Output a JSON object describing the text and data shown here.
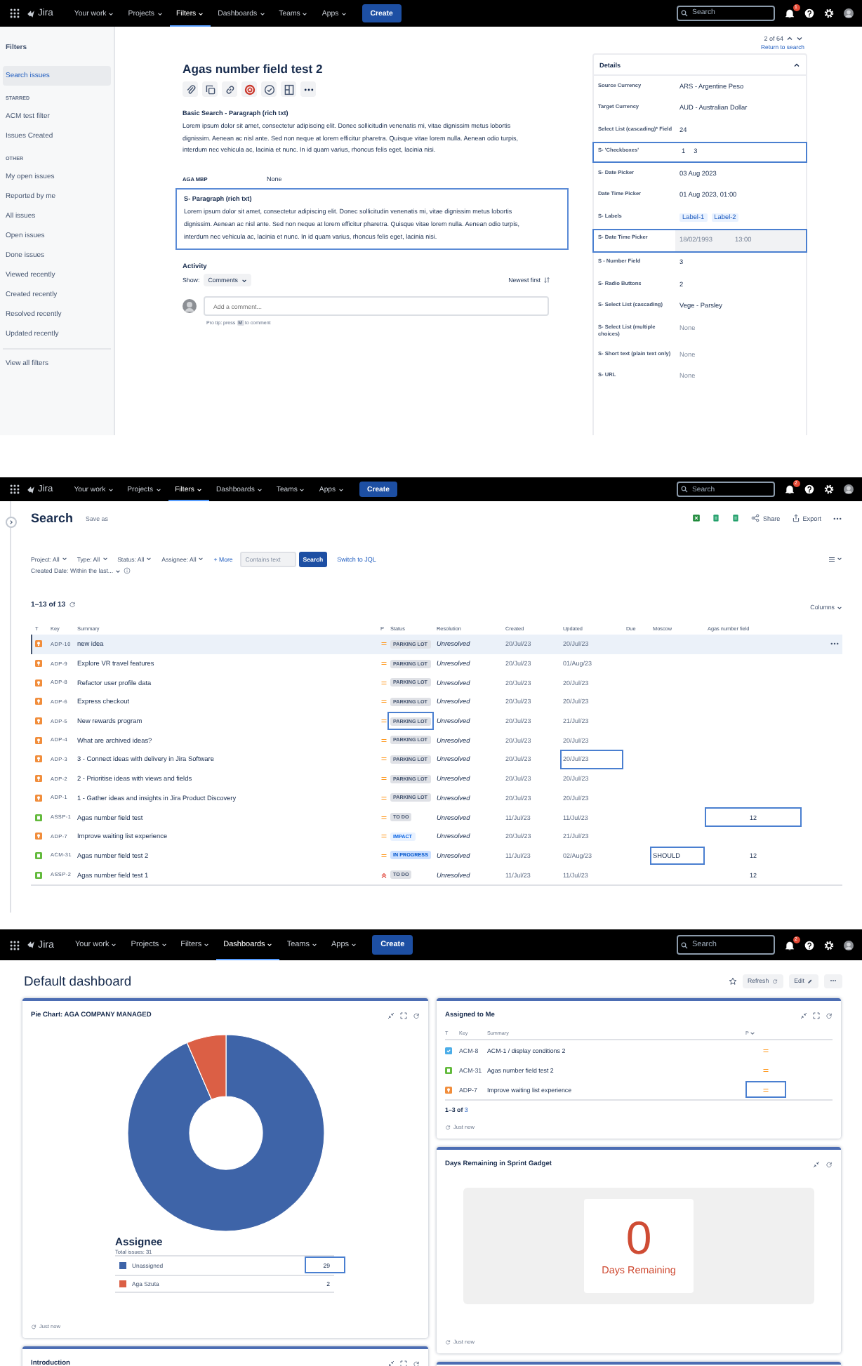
{
  "issue_view": {
    "nav": {
      "product": "Jira",
      "menus": [
        {
          "label": "Your work",
          "selected": false
        },
        {
          "label": "Projects",
          "selected": false
        },
        {
          "label": "Filters",
          "selected": true
        },
        {
          "label": "Dashboards",
          "selected": false
        },
        {
          "label": "Teams",
          "selected": false
        },
        {
          "label": "Apps",
          "selected": false
        }
      ],
      "create": "Create",
      "search_placeholder": "Search",
      "badge": "1"
    },
    "sidebar": {
      "title": "Filters",
      "items": [
        {
          "kind": "item",
          "label": "Search issues",
          "selected": true
        },
        {
          "kind": "heading",
          "label": "STARRED"
        },
        {
          "kind": "item",
          "label": "ACM test filter",
          "selected": false
        },
        {
          "kind": "item",
          "label": "Issues Created",
          "selected": false
        },
        {
          "kind": "heading",
          "label": "OTHER"
        },
        {
          "kind": "item",
          "label": "My open issues",
          "selected": false
        },
        {
          "kind": "item",
          "label": "Reported by me",
          "selected": false
        },
        {
          "kind": "item",
          "label": "All issues",
          "selected": false
        },
        {
          "kind": "item",
          "label": "Open issues",
          "selected": false
        },
        {
          "kind": "item",
          "label": "Done issues",
          "selected": false
        },
        {
          "kind": "item",
          "label": "Viewed recently",
          "selected": false
        },
        {
          "kind": "item",
          "label": "Created recently",
          "selected": false
        },
        {
          "kind": "item",
          "label": "Resolved recently",
          "selected": false
        },
        {
          "kind": "item",
          "label": "Updated recently",
          "selected": false
        }
      ],
      "footer": "View all filters"
    },
    "pager": {
      "position": "2 of 64",
      "link": "Return to search"
    },
    "title": "Agas number field test 2",
    "description": {
      "heading": "Basic Search - Paragraph (rich txt)",
      "text": "Lorem ipsum dolor sit amet, consectetur adipiscing elit. Donec sollicitudin venenatis mi, vitae dignissim metus lobortis dignissim. Aenean ac nisl ante. Sed non neque at lorem efficitur pharetra. Quisque vitae lorem nulla. Aenean odio turpis, interdum nec vehicula ac, lacinia et nunc. In id quam varius, rhoncus felis eget, lacinia nisi."
    },
    "field": {
      "label": "AGA MBP",
      "value": "None"
    },
    "paragraph": {
      "heading": "S- Paragraph (rich txt)",
      "text": "Lorem ipsum dolor sit amet, consectetur adipiscing elit. Donec sollicitudin venenatis mi, vitae dignissim metus lobortis dignissim. Aenean ac nisl ante. Sed non neque at lorem efficitur pharetra. Quisque vitae lorem nulla. Aenean odio turpis, interdum nec vehicula ac, lacinia et nunc. In id quam varius, rhoncus felis eget, lacinia nisi.",
      "highlighted": true
    },
    "activity": {
      "title": "Activity",
      "show_label": "Show:",
      "filter": "Comments",
      "sort": "Newest first",
      "comment_placeholder": "Add a comment...",
      "tip_before": "Pro tip: press",
      "tip_key": "M",
      "tip_after": "to comment"
    },
    "details": {
      "title": "Details",
      "expanded": true,
      "fields": [
        {
          "kind": "text",
          "label": "Source Currency",
          "value": "ARS - Argentine Peso",
          "highlighted": false
        },
        {
          "kind": "text",
          "label": "Target Currency",
          "value": "AUD - Australian Dollar",
          "highlighted": false
        },
        {
          "kind": "text",
          "label": "Select List (cascading)* Field",
          "value": "24",
          "highlighted": false
        },
        {
          "kind": "chips",
          "label": "S- 'Checkboxes'",
          "values": [
            "1",
            "3"
          ],
          "highlighted": true
        },
        {
          "kind": "text",
          "label": "S- Date Picker",
          "value": "03 Aug 2023",
          "highlighted": false
        },
        {
          "kind": "text",
          "label": "Date Time Picker",
          "value": "01 Aug 2023, 01:00",
          "highlighted": false
        },
        {
          "kind": "labels",
          "label": "S- Labels",
          "values": [
            "Label-1",
            "Label-2"
          ],
          "highlighted": false
        },
        {
          "kind": "datetime",
          "label": "S- Date Time Picker",
          "values": [
            "18/02/1993",
            "13:00"
          ],
          "highlighted": true
        },
        {
          "kind": "text",
          "label": "S - Number Field",
          "value": "3",
          "highlighted": false
        },
        {
          "kind": "text",
          "label": "S- Radio Buttons",
          "value": "2",
          "highlighted": false
        },
        {
          "kind": "text",
          "label": "S- Select List (cascading)",
          "value": "Vege - Parsley",
          "highlighted": false
        },
        {
          "kind": "empty",
          "label": "S- Select List (multiple choices)",
          "value": "None",
          "highlighted": false
        },
        {
          "kind": "empty",
          "label": "S- Short text (plain text only)",
          "value": "None",
          "highlighted": false
        },
        {
          "kind": "empty",
          "label": "S- URL",
          "value": "None",
          "highlighted": false
        }
      ]
    }
  },
  "search_view": {
    "nav": {
      "product": "Jira",
      "menus": [
        {
          "label": "Your work",
          "selected": false
        },
        {
          "label": "Projects",
          "selected": false
        },
        {
          "label": "Filters",
          "selected": true
        },
        {
          "label": "Dashboards",
          "selected": false
        },
        {
          "label": "Teams",
          "selected": false
        },
        {
          "label": "Apps",
          "selected": false
        }
      ],
      "create": "Create",
      "search_placeholder": "Search",
      "badge": "2"
    },
    "title": "Search",
    "save_as": "Save as",
    "share": "Share",
    "export": "Export",
    "filters": [
      "Project: All",
      "Type: All",
      "Status: All",
      "Assignee: All"
    ],
    "more": "+ More",
    "text_placeholder": "Contains text",
    "search_button": "Search",
    "jql_link": "Switch to JQL",
    "created_filter": "Created Date: Within the last...",
    "count": "1–13 of 13",
    "columns_button": "Columns",
    "columns": [
      "T",
      "Key",
      "Summary",
      "P",
      "Status",
      "Resolution",
      "Created",
      "Updated",
      "Due",
      "Moscow",
      "Agas number field"
    ],
    "rows": [
      {
        "kind": "idea",
        "key": "ADP-10",
        "summary": "new idea",
        "priority": {
          "kind": "medium"
        },
        "status": {
          "label": "PARKING LOT",
          "kind": "parking"
        },
        "resolution": "Unresolved",
        "created": "20/Jul/23",
        "updated": "20/Jul/23",
        "selected": true,
        "highlight": {
          "kind": "none"
        }
      },
      {
        "kind": "idea",
        "key": "ADP-9",
        "summary": "Explore VR travel features",
        "priority": {
          "kind": "medium"
        },
        "status": {
          "label": "PARKING LOT",
          "kind": "parking"
        },
        "resolution": "Unresolved",
        "created": "20/Jul/23",
        "updated": "01/Aug/23",
        "selected": false,
        "highlight": {
          "kind": "none"
        }
      },
      {
        "kind": "idea",
        "key": "ADP-8",
        "summary": "Refactor user profile data",
        "priority": {
          "kind": "medium"
        },
        "status": {
          "label": "PARKING LOT",
          "kind": "parking"
        },
        "resolution": "Unresolved",
        "created": "20/Jul/23",
        "updated": "20/Jul/23",
        "selected": false,
        "highlight": {
          "kind": "none"
        }
      },
      {
        "kind": "idea",
        "key": "ADP-6",
        "summary": "Express checkout",
        "priority": {
          "kind": "medium"
        },
        "status": {
          "label": "PARKING LOT",
          "kind": "parking"
        },
        "resolution": "Unresolved",
        "created": "20/Jul/23",
        "updated": "20/Jul/23",
        "selected": false,
        "highlight": {
          "kind": "none"
        }
      },
      {
        "kind": "idea",
        "key": "ADP-5",
        "summary": "New rewards program",
        "priority": {
          "kind": "medium"
        },
        "status": {
          "label": "PARKING LOT",
          "kind": "parking"
        },
        "resolution": "Unresolved",
        "created": "20/Jul/23",
        "updated": "21/Jul/23",
        "selected": false,
        "highlight": {
          "kind": "status"
        }
      },
      {
        "kind": "idea",
        "key": "ADP-4",
        "summary": "What are archived ideas?",
        "priority": {
          "kind": "medium"
        },
        "status": {
          "label": "PARKING LOT",
          "kind": "parking"
        },
        "resolution": "Unresolved",
        "created": "20/Jul/23",
        "updated": "20/Jul/23",
        "selected": false,
        "highlight": {
          "kind": "none"
        }
      },
      {
        "kind": "idea",
        "key": "ADP-3",
        "summary": "3 - Connect ideas with delivery in Jira Software",
        "priority": {
          "kind": "medium"
        },
        "status": {
          "label": "PARKING LOT",
          "kind": "parking"
        },
        "resolution": "Unresolved",
        "created": "20/Jul/23",
        "updated": "20/Jul/23",
        "selected": false,
        "highlight": {
          "kind": "updated"
        }
      },
      {
        "kind": "idea",
        "key": "ADP-2",
        "summary": "2 - Prioritise ideas with views and fields",
        "priority": {
          "kind": "medium"
        },
        "status": {
          "label": "PARKING LOT",
          "kind": "parking"
        },
        "resolution": "Unresolved",
        "created": "20/Jul/23",
        "updated": "20/Jul/23",
        "selected": false,
        "highlight": {
          "kind": "none"
        }
      },
      {
        "kind": "idea",
        "key": "ADP-1",
        "summary": "1 - Gather ideas and insights in Jira Product Discovery",
        "priority": {
          "kind": "medium"
        },
        "status": {
          "label": "PARKING LOT",
          "kind": "parking"
        },
        "resolution": "Unresolved",
        "created": "20/Jul/23",
        "updated": "20/Jul/23",
        "selected": false,
        "highlight": {
          "kind": "none"
        }
      },
      {
        "kind": "story",
        "key": "ASSP-1",
        "summary": "Agas number field test",
        "priority": {
          "kind": "medium"
        },
        "status": {
          "label": "TO DO",
          "kind": "todo"
        },
        "resolution": "Unresolved",
        "created": "11/Jul/23",
        "updated": "11/Jul/23",
        "number": "12",
        "selected": false,
        "highlight": {
          "kind": "number"
        }
      },
      {
        "kind": "idea",
        "key": "ADP-7",
        "summary": "Improve waiting list experience",
        "priority": {
          "kind": "medium"
        },
        "status": {
          "label": "IMPACT",
          "kind": "impact"
        },
        "resolution": "Unresolved",
        "created": "20/Jul/23",
        "updated": "21/Jul/23",
        "selected": false,
        "highlight": {
          "kind": "none"
        }
      },
      {
        "kind": "story",
        "key": "ACM-31",
        "summary": "Agas number field test 2",
        "priority": {
          "kind": "medium"
        },
        "status": {
          "label": "IN PROGRESS",
          "kind": "progress"
        },
        "resolution": "Unresolved",
        "created": "11/Jul/23",
        "updated": "02/Aug/23",
        "moscow": "SHOULD",
        "number": "12",
        "selected": false,
        "highlight": {
          "kind": "moscow"
        }
      },
      {
        "kind": "story",
        "key": "ASSP-2",
        "summary": "Agas number field test 1",
        "priority": {
          "kind": "high"
        },
        "status": {
          "label": "TO DO",
          "kind": "todo"
        },
        "resolution": "Unresolved",
        "created": "11/Jul/23",
        "updated": "11/Jul/23",
        "number": "12",
        "selected": false,
        "highlight": {
          "kind": "none"
        }
      }
    ]
  },
  "dashboard": {
    "nav": {
      "product": "Jira",
      "menus": [
        {
          "label": "Your work",
          "selected": false
        },
        {
          "label": "Projects",
          "selected": false
        },
        {
          "label": "Filters",
          "selected": false
        },
        {
          "label": "Dashboards",
          "selected": true
        },
        {
          "label": "Teams",
          "selected": false
        },
        {
          "label": "Apps",
          "selected": false
        }
      ],
      "create": "Create",
      "search_placeholder": "Search",
      "badge": "2"
    },
    "title": "Default dashboard",
    "refresh": "Refresh",
    "edit": "Edit",
    "pie_gadget": {
      "title": "Pie Chart: AGA COMPANY MANAGED",
      "chart_data": {
        "type": "donut",
        "categories": [
          "Unassigned",
          "Aga Szuta"
        ],
        "series": [
          {
            "name": "Assignee",
            "values": [
              93.5,
              6.5
            ]
          }
        ]
      },
      "total": "Total issues: 31",
      "legend": [
        {
          "count": "29",
          "color": "#3e64a8",
          "highlighted": true
        },
        {
          "count": "2",
          "color": "#db5f45",
          "highlighted": false
        }
      ],
      "updated": "Just now"
    },
    "assigned_gadget": {
      "title": "Assigned to Me",
      "columns": [
        "T",
        "Key",
        "Summary",
        "P"
      ],
      "rows": [
        {
          "kind": "task",
          "key": "ACM-8",
          "summary": "ACM-1 / display conditions 2",
          "priority": {
            "kind": "medium"
          },
          "highlighted": false
        },
        {
          "kind": "story",
          "key": "ACM-31",
          "summary": "Agas number field test 2",
          "priority": {
            "kind": "medium"
          },
          "highlighted": false
        },
        {
          "kind": "idea",
          "key": "ADP-7",
          "summary": "Improve waiting list experience",
          "priority": {
            "kind": "medium"
          },
          "highlighted": true
        }
      ],
      "count": "1–3 of",
      "count_link": "3",
      "updated": "Just now"
    },
    "sprint_gadget": {
      "title": "Days Remaining in Sprint Gadget",
      "days": "0",
      "caption": "Days Remaining",
      "updated": "Just now"
    },
    "intro_gadget": {
      "title": "Introduction"
    }
  }
}
